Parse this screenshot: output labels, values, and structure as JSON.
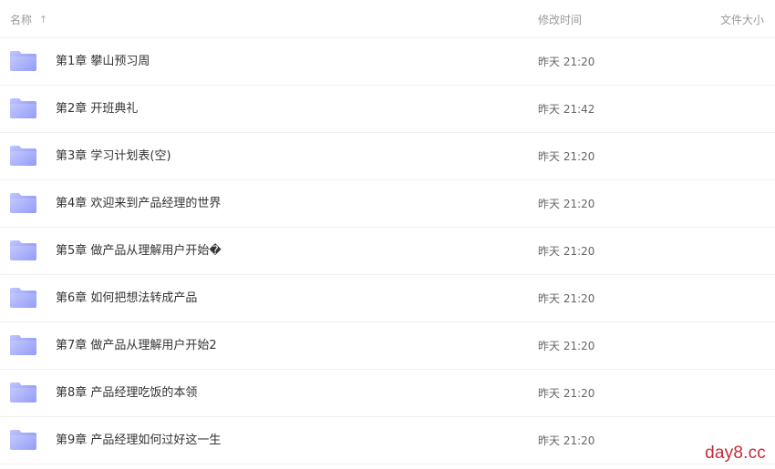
{
  "header": {
    "name_label": "名称",
    "sort_icon": "↑",
    "time_label": "修改时间",
    "size_label": "文件大小"
  },
  "files": [
    {
      "name": "第1章 攀山预习周",
      "time": "昨天 21:20"
    },
    {
      "name": "第2章 开班典礼",
      "time": "昨天 21:42"
    },
    {
      "name": "第3章 学习计划表(空)",
      "time": "昨天 21:20"
    },
    {
      "name": "第4章 欢迎来到产品经理的世界",
      "time": "昨天 21:20"
    },
    {
      "name": "第5章 做产品从理解用户开始�",
      "time": "昨天 21:20"
    },
    {
      "name": "第6章 如何把想法转成产品",
      "time": "昨天 21:20"
    },
    {
      "name": "第7章 做产品从理解用户开始2",
      "time": "昨天 21:20"
    },
    {
      "name": "第8章 产品经理吃饭的本领",
      "time": "昨天 21:20"
    },
    {
      "name": "第9章 产品经理如何过好这一生",
      "time": "昨天 21:20"
    }
  ],
  "watermark": "day8.cc",
  "colors": {
    "folder_light": "#b9c1ff",
    "folder_dark": "#7d86f5",
    "watermark": "#c8283a",
    "divider": "#f0f0f0"
  }
}
